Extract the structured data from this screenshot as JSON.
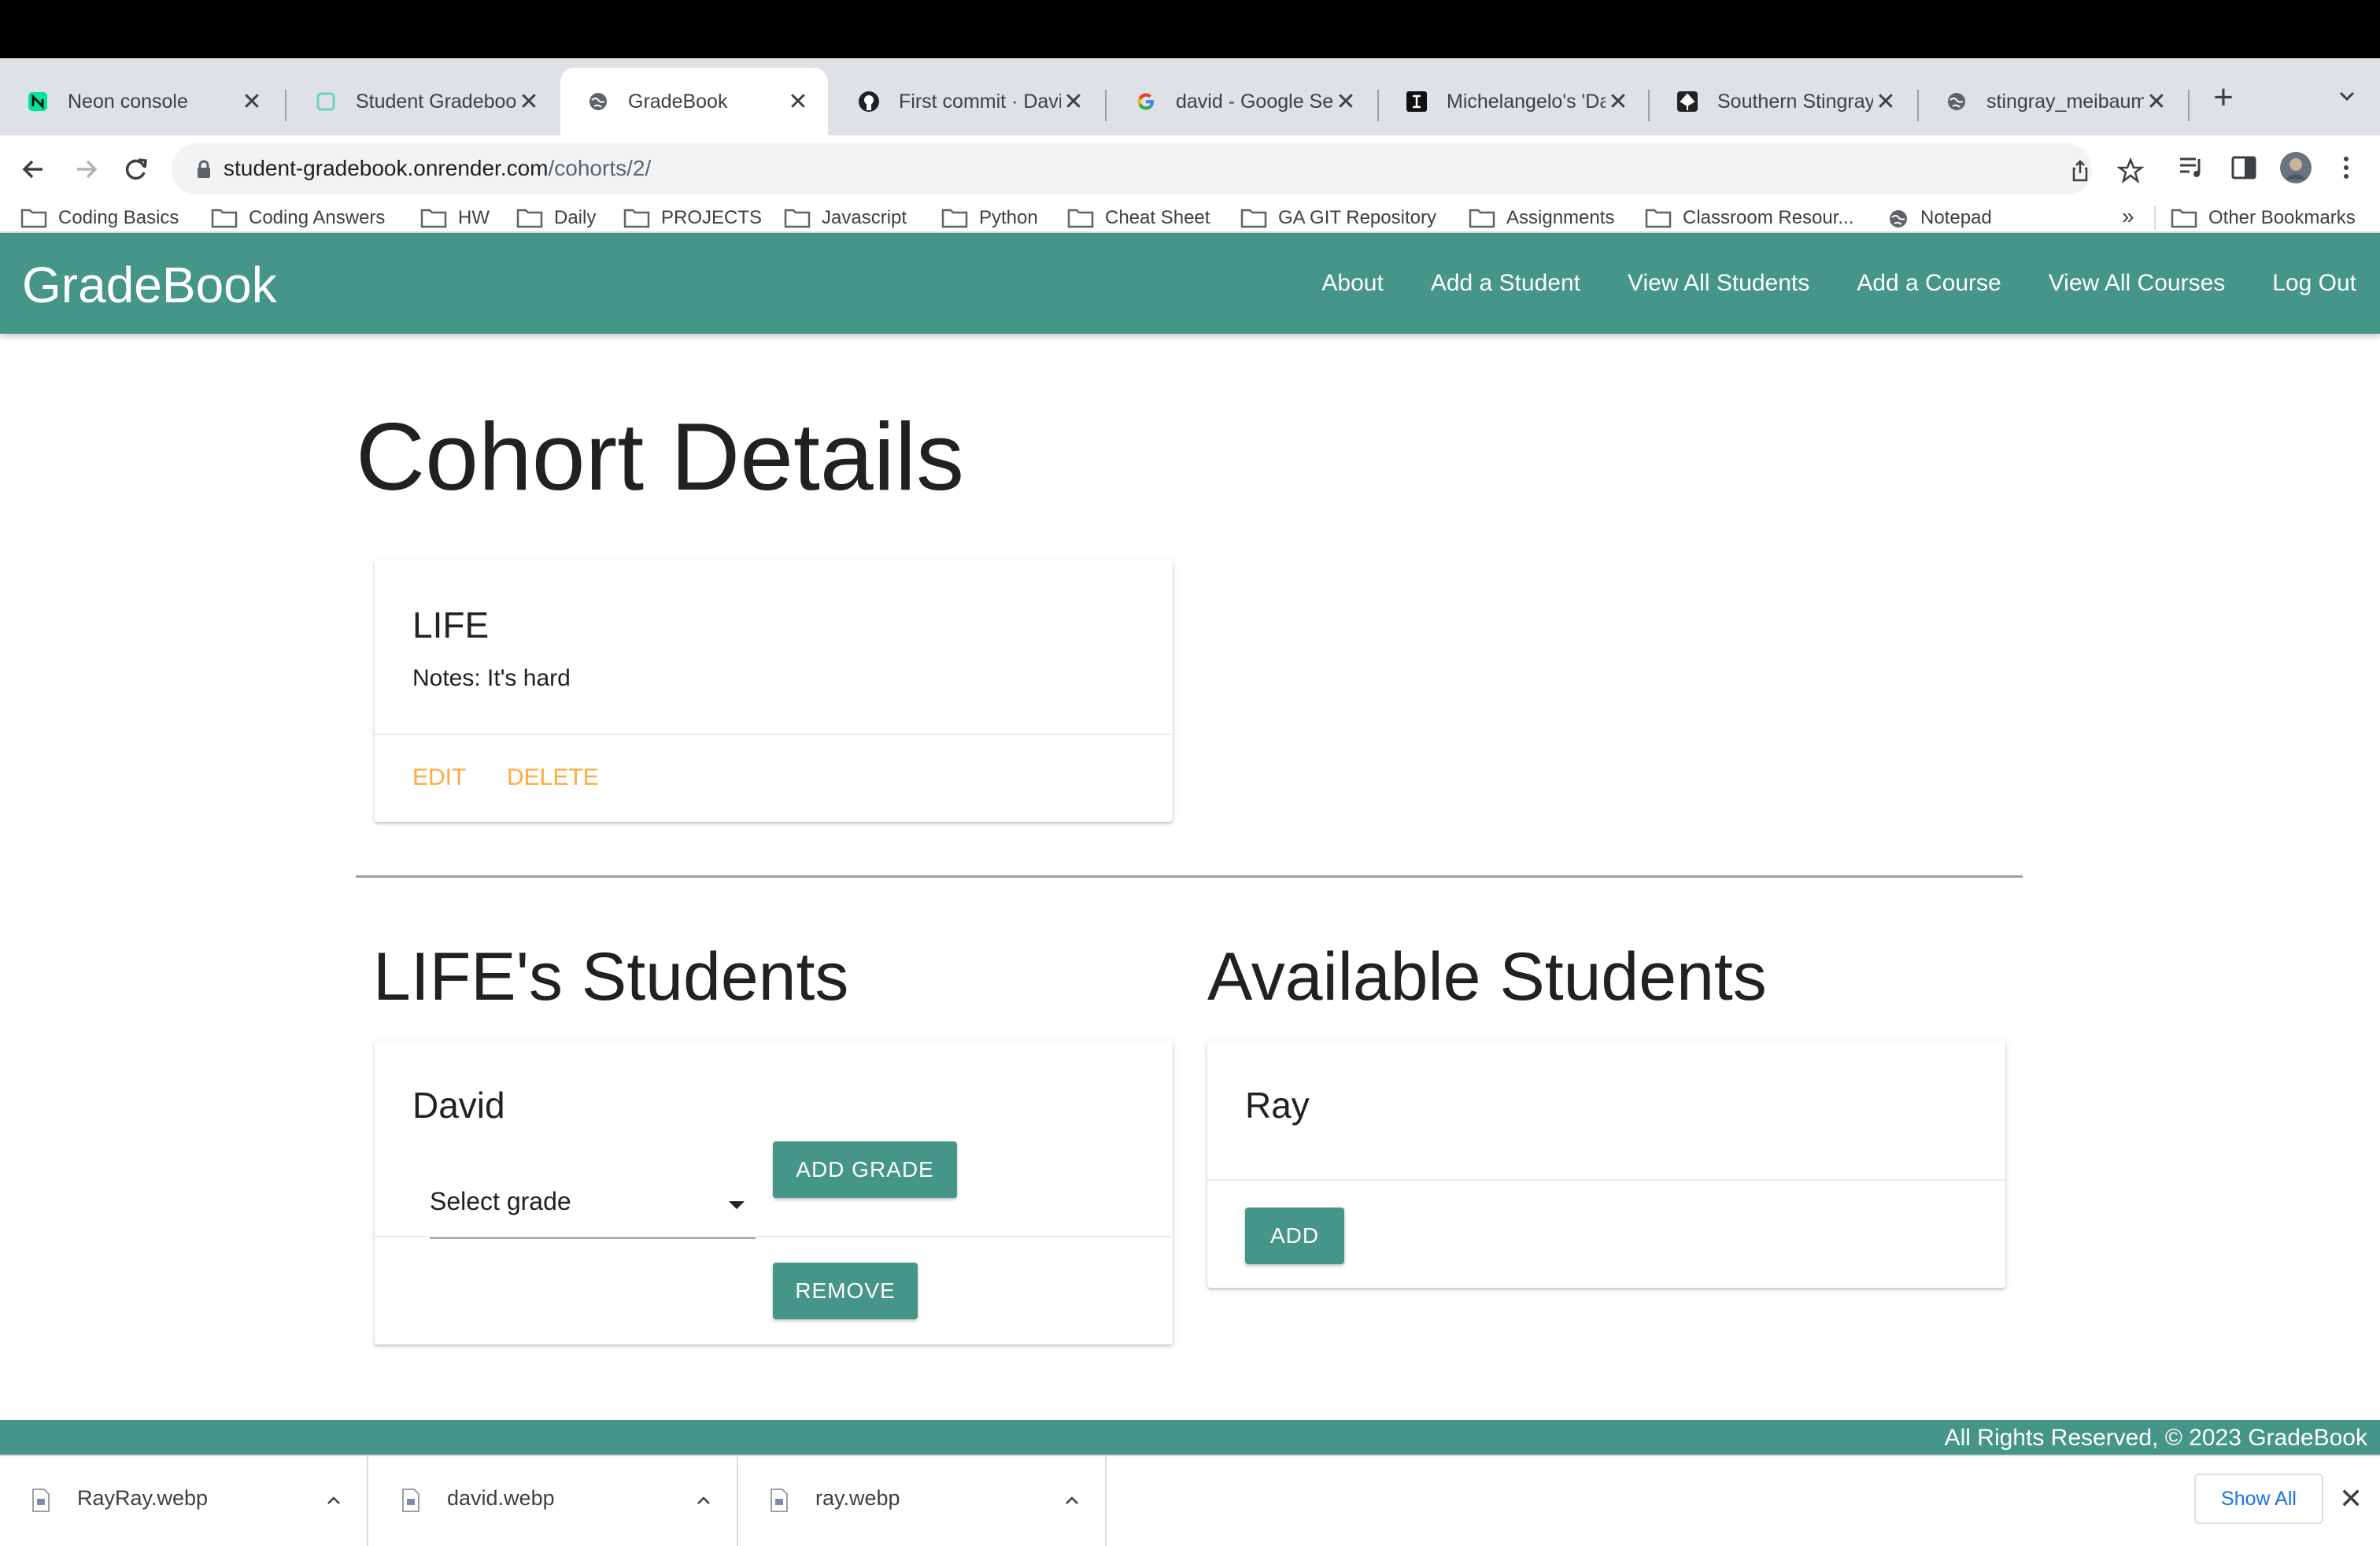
{
  "browser": {
    "tabs": [
      {
        "title": "Neon console",
        "icon": "neon-icon",
        "active": false
      },
      {
        "title": "Student Gradebook",
        "icon": "render-icon",
        "active": false
      },
      {
        "title": "GradeBook",
        "icon": "globe-icon",
        "active": true
      },
      {
        "title": "First commit · David",
        "icon": "github-icon",
        "active": false
      },
      {
        "title": "david - Google Search",
        "icon": "google-icon",
        "active": false
      },
      {
        "title": "Michelangelo's 'David'",
        "icon": "letter-icon",
        "active": false
      },
      {
        "title": "Southern Stingray",
        "icon": "stingray-icon",
        "active": false
      },
      {
        "title": "stingray_meibaum",
        "icon": "globe-icon",
        "active": false
      }
    ],
    "tab_close_glyph": "✕",
    "new_tab_glyph": "+",
    "url_host": "student-gradebook.onrender.com",
    "url_path": "/cohorts/2/",
    "bookmarks": [
      {
        "label": "Coding Basics",
        "icon": "folder-icon"
      },
      {
        "label": "Coding Answers",
        "icon": "folder-icon"
      },
      {
        "label": "HW",
        "icon": "folder-icon"
      },
      {
        "label": "Daily",
        "icon": "folder-icon"
      },
      {
        "label": "PROJECTS",
        "icon": "folder-icon"
      },
      {
        "label": "Javascript",
        "icon": "folder-icon"
      },
      {
        "label": "Python",
        "icon": "folder-icon"
      },
      {
        "label": "Cheat Sheet",
        "icon": "folder-icon"
      },
      {
        "label": "GA GIT Repository",
        "icon": "folder-icon"
      },
      {
        "label": "Assignments",
        "icon": "folder-icon"
      },
      {
        "label": "Classroom Resour...",
        "icon": "folder-icon"
      },
      {
        "label": "Notepad",
        "icon": "globe-icon"
      }
    ],
    "bookmarks_overflow": "»",
    "other_bookmarks": "Other Bookmarks"
  },
  "app": {
    "brand": "GradeBook",
    "nav": [
      "About",
      "Add a Student",
      "View All Students",
      "Add a Course",
      "View All Courses",
      "Log Out"
    ],
    "accent_color": "#459689",
    "link_color": "#ffab40"
  },
  "page": {
    "title": "Cohort Details",
    "cohort": {
      "name": "LIFE",
      "notes": "Notes: It's hard",
      "edit_label": "EDIT",
      "delete_label": "DELETE"
    },
    "enrolled": {
      "heading": "LIFE's Students",
      "students": [
        {
          "name": "David",
          "select_value": "Select grade",
          "add_grade_label": "ADD GRADE",
          "remove_label": "REMOVE"
        }
      ]
    },
    "available": {
      "heading": "Available Students",
      "students": [
        {
          "name": "Ray",
          "add_label": "ADD"
        }
      ]
    }
  },
  "footer": {
    "copyright": "All Rights Reserved, © 2023 GradeBook"
  },
  "downloads": {
    "items": [
      "RayRay.webp",
      "david.webp",
      "ray.webp"
    ],
    "show_all_label": "Show All",
    "close_glyph": "✕"
  }
}
